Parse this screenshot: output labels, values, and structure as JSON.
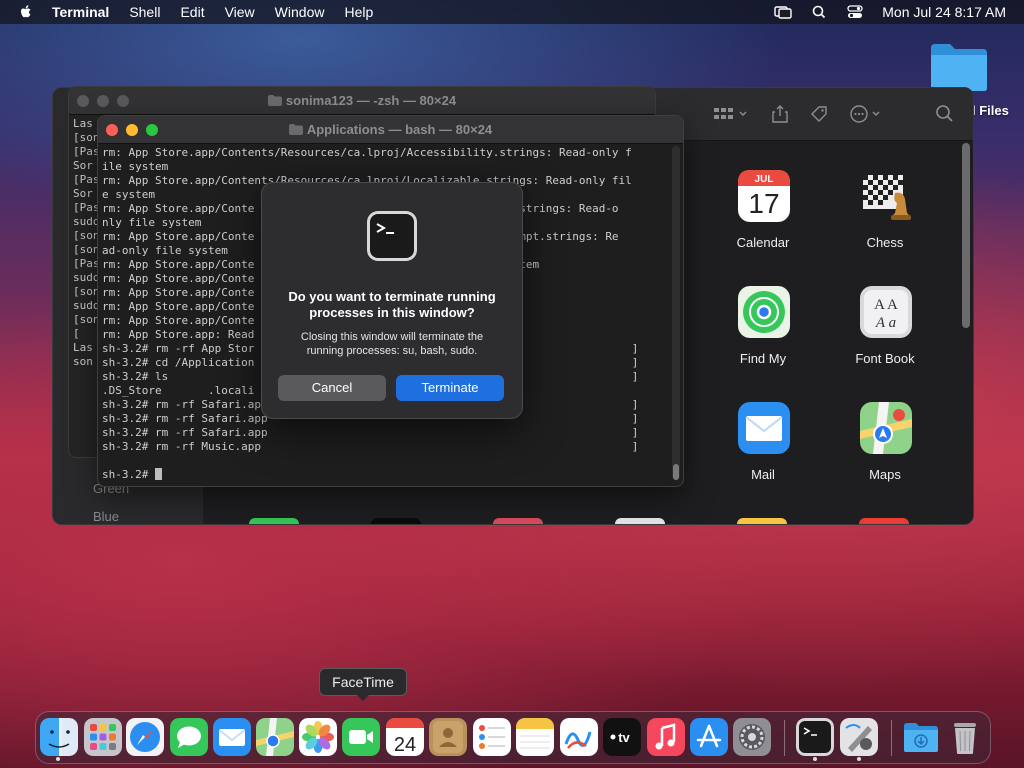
{
  "menubar": {
    "app": "Terminal",
    "items": [
      "Shell",
      "Edit",
      "View",
      "Window",
      "Help"
    ],
    "datetime": "Mon Jul 24  8:17 AM"
  },
  "desktop": {
    "folder_label": "l Files"
  },
  "finder": {
    "sidebar_tags": [
      "Green",
      "Blue"
    ],
    "apps": [
      {
        "label": "Calendar",
        "month": "JUL",
        "day": "17"
      },
      {
        "label": "Chess"
      },
      {
        "label": "Find My"
      },
      {
        "label": "Font Book",
        "glyphs": "AA Aa"
      },
      {
        "label": "Mail"
      },
      {
        "label": "Maps"
      }
    ]
  },
  "term_back": {
    "title": "sonima123 — -zsh — 80×24",
    "lines": [
      "Las",
      "[son",
      "[Pas",
      "Sor",
      "[Pas",
      "Sor",
      "[Pas",
      "sudo",
      "[son",
      "[son",
      "[Pas",
      "sudo",
      "[son",
      "sudo",
      "[son",
      "[ ",
      "Las",
      "son"
    ]
  },
  "term_front": {
    "title": "Applications — bash — 80×24",
    "lines": [
      "rm: App Store.app/Contents/Resources/ca.lproj/Accessibility.strings: Read-only f",
      "ile system",
      "rm: App Store.app/Contents/Resources/ca.lproj/Localizable.strings: Read-only fil",
      "e system",
      "rm: App Store.app/Conte                                   kbox.strings: Read-o",
      "nly file system",
      "rm: App Store.app/Conte                                   onPrompt.strings: Re",
      "ad-only file system",
      "rm: App Store.app/Conte                                   e system",
      "rm: App Store.app/Conte",
      "rm: App Store.app/Conte",
      "rm: App Store.app/Conte                                   stem",
      "rm: App Store.app/Conte",
      "rm: App Store.app: Read",
      "sh-3.2# rm -rf App Stor                                                         ]",
      "sh-3.2# cd /Application                                                         ]",
      "sh-3.2# ls                                                                      ]",
      ".DS_Store       .locali",
      "sh-3.2# rm -rf Safari.app                                                       ]",
      "sh-3.2# rm -rf Safari.app                                                       ]",
      "sh-3.2# rm -rf Safari.app                                                       ]",
      "sh-3.2# rm -rf Music.app                                                        ]"
    ],
    "prompt": "sh-3.2# "
  },
  "dialog": {
    "title": "Do you want to terminate running processes in this window?",
    "message": "Closing this window will terminate the running processes: su, bash, sudo.",
    "cancel": "Cancel",
    "confirm": "Terminate"
  },
  "tooltip": "FaceTime",
  "dock": {
    "calendar_day": "24",
    "tv_label": "tv"
  },
  "colors": {
    "accent": "#1f6fe0",
    "folder": "#3da4f0"
  }
}
